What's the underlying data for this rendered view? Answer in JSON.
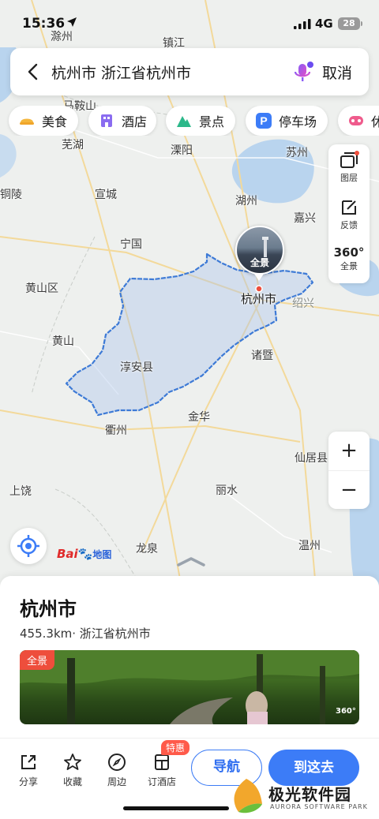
{
  "status_bar": {
    "time": "15:36",
    "network": "4G",
    "battery": "28"
  },
  "search": {
    "query": "杭州市 浙江省杭州市",
    "cancel_label": "取消"
  },
  "categories": [
    {
      "label": "美食",
      "icon": "food-icon"
    },
    {
      "label": "酒店",
      "icon": "hotel-icon"
    },
    {
      "label": "景点",
      "icon": "scenic-icon"
    },
    {
      "label": "停车场",
      "icon": "parking-icon"
    },
    {
      "label": "休",
      "icon": "leisure-icon"
    }
  ],
  "map_tools": {
    "layers_label": "图层",
    "feedback_label": "反馈",
    "pano_glyph": "360°",
    "pano_label": "全景",
    "zoom_in": "+",
    "zoom_out": "−"
  },
  "map_labels": {
    "chuzhou": "滁州",
    "zhenjiang": "镇江",
    "maanshan": "马鞍山",
    "wuhu": "芜湖",
    "liyang": "溧阳",
    "suzhou": "苏州",
    "tongling": "铜陵",
    "xuancheng": "宣城",
    "huzhou": "湖州",
    "jiaxing": "嘉兴",
    "ningguo": "宁国",
    "huangshanqu": "黄山区",
    "hangzhou": "杭州市",
    "shaoxing": "绍兴",
    "huangshan": "黄山",
    "zhuji": "诸暨",
    "chunan": "淳安县",
    "jinhua": "金华",
    "quzhou": "衢州",
    "xianju": "仙居县",
    "shangrao": "上饶",
    "lishui": "丽水",
    "longquan": "龙泉",
    "wenzhou": "温州",
    "pano_bubble": "全景"
  },
  "logo": {
    "bai": "Bai",
    "du": "du",
    "map_word": "地图"
  },
  "place": {
    "name": "杭州市",
    "distance": "455.3km",
    "region": "浙江省杭州市",
    "photo_tag": "全景",
    "photo_360": "360°"
  },
  "actions": [
    {
      "label": "分享",
      "icon": "share-icon"
    },
    {
      "label": "收藏",
      "icon": "star-icon"
    },
    {
      "label": "周边",
      "icon": "compass-icon"
    },
    {
      "label": "订酒店",
      "icon": "hotel-book-icon"
    }
  ],
  "deal_badge": "特惠",
  "nav_button": "导航",
  "go_button": "到这去",
  "watermark": {
    "name": "极光软件园",
    "sub": "AURORA SOFTWARE PARK"
  },
  "colors": {
    "accent": "#3c7cf7",
    "boundary": "#3d7ad6",
    "badge_red": "#ee4e3c"
  }
}
